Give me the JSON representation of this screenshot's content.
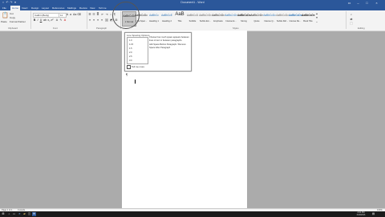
{
  "title_bar": {
    "title": "Document1 - Word"
  },
  "tabs": [
    "File",
    "Home",
    "Insert",
    "Design",
    "Layout",
    "References",
    "Mailings",
    "Review",
    "View",
    "Tell me"
  ],
  "clipboard": {
    "paste": "Paste",
    "cut": "Cut",
    "copy": "Copy",
    "format_painter": "Format Painter",
    "group": "Clipboard"
  },
  "font": {
    "family": "Calibri (Body)",
    "size": "11",
    "group": "Font"
  },
  "paragraph": {
    "group": "Paragraph"
  },
  "styles": {
    "group": "Styles",
    "items": [
      {
        "preview": "AaBbCcDc",
        "name": "1 Normal"
      },
      {
        "preview": "AaBbCcDc",
        "name": "1 No Spac..."
      },
      {
        "preview": "AaBbCc",
        "name": "Heading 1"
      },
      {
        "preview": "AaBbCcE",
        "name": "Heading 2"
      },
      {
        "preview": "AaB",
        "name": "Title"
      },
      {
        "preview": "AaBbCcD",
        "name": "Subtitle"
      },
      {
        "preview": "AaBbCcDc",
        "name": "Subtle Em..."
      },
      {
        "preview": "AaBbCcDc",
        "name": "Emphasis"
      },
      {
        "preview": "AaBbCcDc",
        "name": "Intense E..."
      },
      {
        "preview": "AaBbCcDc",
        "name": "Strong"
      },
      {
        "preview": "AaBbCcDc",
        "name": "Quote"
      },
      {
        "preview": "AaBbCcDc",
        "name": "Intense Q..."
      },
      {
        "preview": "AaBbCcDc",
        "name": "Subtle Ref..."
      },
      {
        "preview": "AaBbCcDc",
        "name": "Intense Re..."
      },
      {
        "preview": "AaBbCcDc",
        "name": "Book Title"
      }
    ]
  },
  "editing": {
    "group": "Editing"
  },
  "dropdown": {
    "title": "Line Spacing Options",
    "items": [
      "1.0",
      "1.15",
      "1.5",
      "2.0",
      "2.5",
      "3.0"
    ],
    "description": "Choose how much space appears between lines of text or between paragraphs.",
    "description2": "Add Space Before Paragraph / Remove Space After Paragraph",
    "link": "Tell me more"
  },
  "status_bar": {
    "page": "Page 1 of 1",
    "words": "0 words",
    "zoom": "100%"
  },
  "taskbar": {
    "time": "2:04 PM",
    "date": "3/10/2016"
  }
}
